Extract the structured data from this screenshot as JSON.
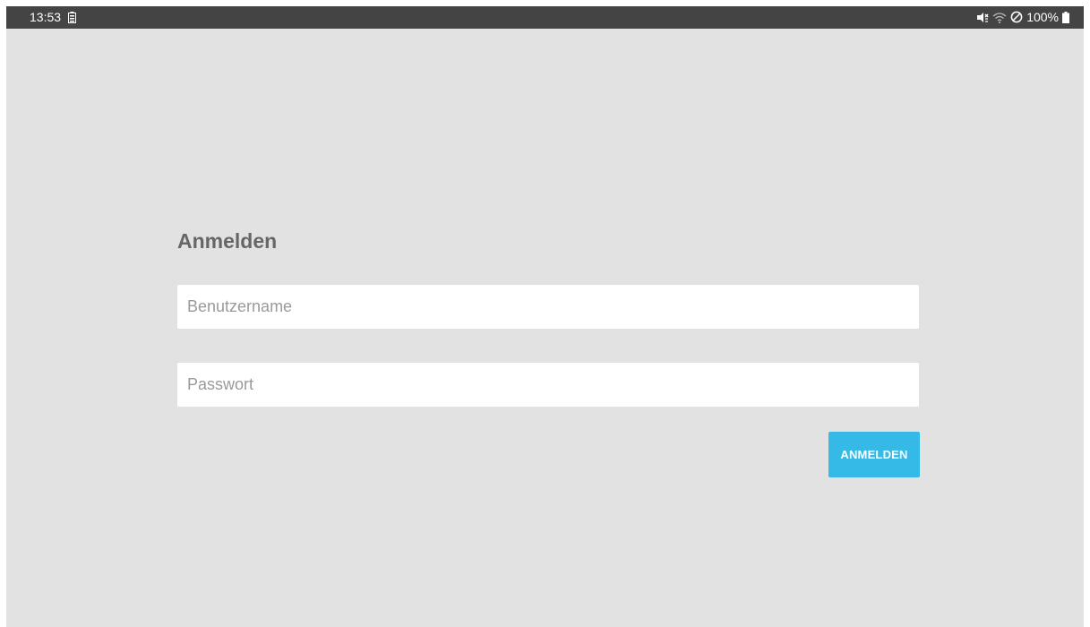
{
  "statusbar": {
    "time": "13:53",
    "battery_percent": "100%",
    "icons": [
      "battery-saver-icon",
      "mute-vibrate-icon",
      "wifi-icon",
      "do-not-disturb-icon",
      "battery-icon"
    ]
  },
  "login": {
    "title": "Anmelden",
    "username": {
      "value": "",
      "placeholder": "Benutzername"
    },
    "password": {
      "value": "",
      "placeholder": "Passwort"
    },
    "submit_label": "ANMELDEN"
  },
  "colors": {
    "background": "#e2e2e2",
    "statusbar": "#444444",
    "accent": "#35b9e6",
    "title": "#666666"
  }
}
